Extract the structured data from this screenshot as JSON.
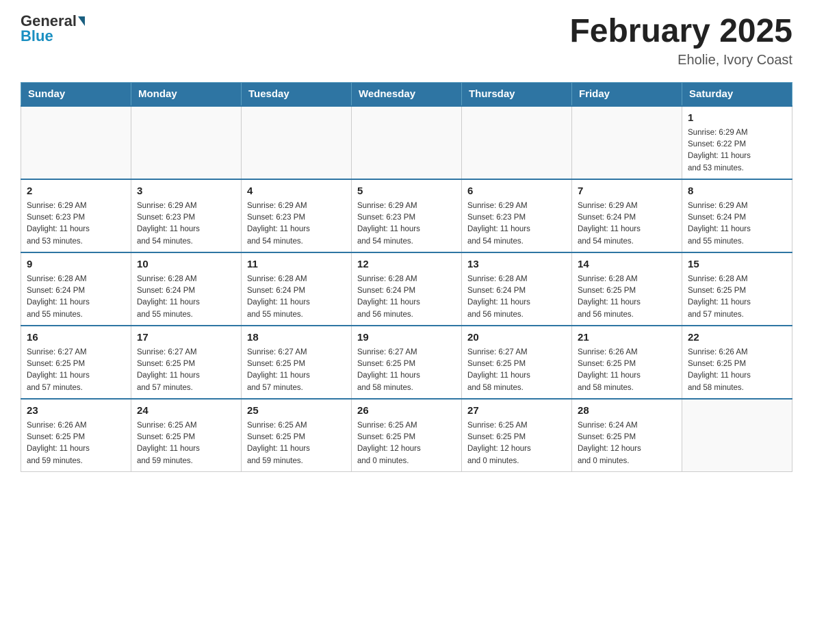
{
  "header": {
    "logo_general": "General",
    "logo_blue": "Blue",
    "month_title": "February 2025",
    "location": "Eholie, Ivory Coast"
  },
  "weekdays": [
    "Sunday",
    "Monday",
    "Tuesday",
    "Wednesday",
    "Thursday",
    "Friday",
    "Saturday"
  ],
  "weeks": [
    [
      {
        "day": "",
        "info": ""
      },
      {
        "day": "",
        "info": ""
      },
      {
        "day": "",
        "info": ""
      },
      {
        "day": "",
        "info": ""
      },
      {
        "day": "",
        "info": ""
      },
      {
        "day": "",
        "info": ""
      },
      {
        "day": "1",
        "info": "Sunrise: 6:29 AM\nSunset: 6:22 PM\nDaylight: 11 hours\nand 53 minutes."
      }
    ],
    [
      {
        "day": "2",
        "info": "Sunrise: 6:29 AM\nSunset: 6:23 PM\nDaylight: 11 hours\nand 53 minutes."
      },
      {
        "day": "3",
        "info": "Sunrise: 6:29 AM\nSunset: 6:23 PM\nDaylight: 11 hours\nand 54 minutes."
      },
      {
        "day": "4",
        "info": "Sunrise: 6:29 AM\nSunset: 6:23 PM\nDaylight: 11 hours\nand 54 minutes."
      },
      {
        "day": "5",
        "info": "Sunrise: 6:29 AM\nSunset: 6:23 PM\nDaylight: 11 hours\nand 54 minutes."
      },
      {
        "day": "6",
        "info": "Sunrise: 6:29 AM\nSunset: 6:23 PM\nDaylight: 11 hours\nand 54 minutes."
      },
      {
        "day": "7",
        "info": "Sunrise: 6:29 AM\nSunset: 6:24 PM\nDaylight: 11 hours\nand 54 minutes."
      },
      {
        "day": "8",
        "info": "Sunrise: 6:29 AM\nSunset: 6:24 PM\nDaylight: 11 hours\nand 55 minutes."
      }
    ],
    [
      {
        "day": "9",
        "info": "Sunrise: 6:28 AM\nSunset: 6:24 PM\nDaylight: 11 hours\nand 55 minutes."
      },
      {
        "day": "10",
        "info": "Sunrise: 6:28 AM\nSunset: 6:24 PM\nDaylight: 11 hours\nand 55 minutes."
      },
      {
        "day": "11",
        "info": "Sunrise: 6:28 AM\nSunset: 6:24 PM\nDaylight: 11 hours\nand 55 minutes."
      },
      {
        "day": "12",
        "info": "Sunrise: 6:28 AM\nSunset: 6:24 PM\nDaylight: 11 hours\nand 56 minutes."
      },
      {
        "day": "13",
        "info": "Sunrise: 6:28 AM\nSunset: 6:24 PM\nDaylight: 11 hours\nand 56 minutes."
      },
      {
        "day": "14",
        "info": "Sunrise: 6:28 AM\nSunset: 6:25 PM\nDaylight: 11 hours\nand 56 minutes."
      },
      {
        "day": "15",
        "info": "Sunrise: 6:28 AM\nSunset: 6:25 PM\nDaylight: 11 hours\nand 57 minutes."
      }
    ],
    [
      {
        "day": "16",
        "info": "Sunrise: 6:27 AM\nSunset: 6:25 PM\nDaylight: 11 hours\nand 57 minutes."
      },
      {
        "day": "17",
        "info": "Sunrise: 6:27 AM\nSunset: 6:25 PM\nDaylight: 11 hours\nand 57 minutes."
      },
      {
        "day": "18",
        "info": "Sunrise: 6:27 AM\nSunset: 6:25 PM\nDaylight: 11 hours\nand 57 minutes."
      },
      {
        "day": "19",
        "info": "Sunrise: 6:27 AM\nSunset: 6:25 PM\nDaylight: 11 hours\nand 58 minutes."
      },
      {
        "day": "20",
        "info": "Sunrise: 6:27 AM\nSunset: 6:25 PM\nDaylight: 11 hours\nand 58 minutes."
      },
      {
        "day": "21",
        "info": "Sunrise: 6:26 AM\nSunset: 6:25 PM\nDaylight: 11 hours\nand 58 minutes."
      },
      {
        "day": "22",
        "info": "Sunrise: 6:26 AM\nSunset: 6:25 PM\nDaylight: 11 hours\nand 58 minutes."
      }
    ],
    [
      {
        "day": "23",
        "info": "Sunrise: 6:26 AM\nSunset: 6:25 PM\nDaylight: 11 hours\nand 59 minutes."
      },
      {
        "day": "24",
        "info": "Sunrise: 6:25 AM\nSunset: 6:25 PM\nDaylight: 11 hours\nand 59 minutes."
      },
      {
        "day": "25",
        "info": "Sunrise: 6:25 AM\nSunset: 6:25 PM\nDaylight: 11 hours\nand 59 minutes."
      },
      {
        "day": "26",
        "info": "Sunrise: 6:25 AM\nSunset: 6:25 PM\nDaylight: 12 hours\nand 0 minutes."
      },
      {
        "day": "27",
        "info": "Sunrise: 6:25 AM\nSunset: 6:25 PM\nDaylight: 12 hours\nand 0 minutes."
      },
      {
        "day": "28",
        "info": "Sunrise: 6:24 AM\nSunset: 6:25 PM\nDaylight: 12 hours\nand 0 minutes."
      },
      {
        "day": "",
        "info": ""
      }
    ]
  ]
}
